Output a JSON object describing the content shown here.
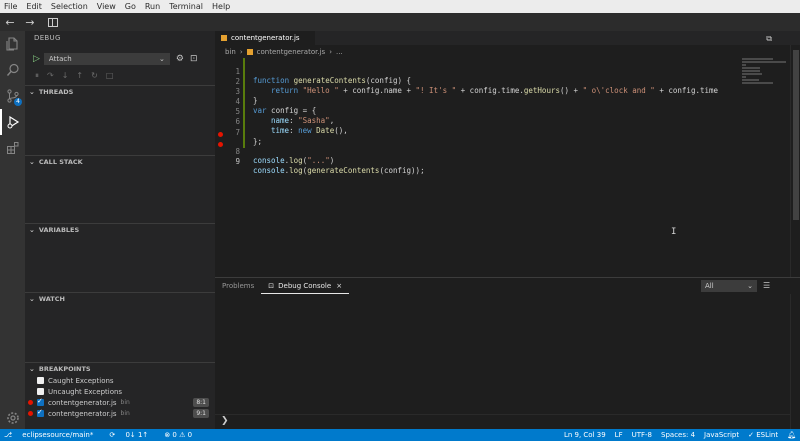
{
  "menu": [
    "File",
    "Edit",
    "Selection",
    "View",
    "Go",
    "Run",
    "Terminal",
    "Help"
  ],
  "nav": {
    "back": "←",
    "forward": "→"
  },
  "sidebar": {
    "title": "DEBUG",
    "config_value": "Attach",
    "sections": {
      "threads": "THREADS",
      "call_stack": "CALL STACK",
      "variables": "VARIABLES",
      "watch": "WATCH",
      "breakpoints": "BREAKPOINTS"
    },
    "breakpoints": [
      {
        "label": "Caught Exceptions",
        "checked": false
      },
      {
        "label": "Uncaught Exceptions",
        "checked": false
      },
      {
        "label": "contentgenerator.js",
        "folder": "bin",
        "line": "8:1",
        "checked": true
      },
      {
        "label": "contentgenerator.js",
        "folder": "bin",
        "line": "9:1",
        "checked": true
      }
    ]
  },
  "activity": {
    "scm_badge": "4"
  },
  "editor": {
    "tab_label": "contentgenerator.js",
    "breadcrumb": [
      "bin",
      "contentgenerator.js",
      "..."
    ],
    "line_numbers": [
      "1",
      "2",
      "3",
      "4",
      "5",
      "6",
      "7",
      "8",
      "9"
    ],
    "code": {
      "l1": {
        "kw": "function",
        "fn": "generateContents",
        "rest": "(config) {"
      },
      "l2": {
        "kw": "return",
        "s1": "\"Hello \"",
        "p1": " + config.name + ",
        "s2": "\"! It's \"",
        "p2": " + config.time.",
        "fn": "getHours",
        "p3": "() + ",
        "s3": "\" o\\'clock and \"",
        "p4": " + config.time"
      },
      "l3": "}",
      "l4": {
        "kw": "var",
        "rest": " config = {"
      },
      "l5": {
        "key": "name",
        "val": "\"Sasha\"",
        "end": ","
      },
      "l6": {
        "key": "time",
        "kw": "new",
        "fn": "Date",
        "end": "(),"
      },
      "l7": "};",
      "l8": {
        "obj": "console",
        "fn": "log",
        "str": "\"...\""
      },
      "l9": {
        "obj": "console",
        "fn": "log",
        "fn2": "generateContents",
        "rest": "(config));"
      }
    }
  },
  "panel": {
    "tabs": [
      "Problems",
      "Debug Console"
    ],
    "filter_value": "All",
    "prompt": "❯"
  },
  "status": {
    "branch": "eclipsesource/main*",
    "sync": "0↓ 1↑",
    "problems": "⊗ 0 ⚠ 0",
    "position": "Ln 9, Col 39",
    "eol": "LF",
    "encoding": "UTF-8",
    "spaces": "Spaces: 4",
    "language": "JavaScript",
    "linter": "✓ ESLint"
  }
}
